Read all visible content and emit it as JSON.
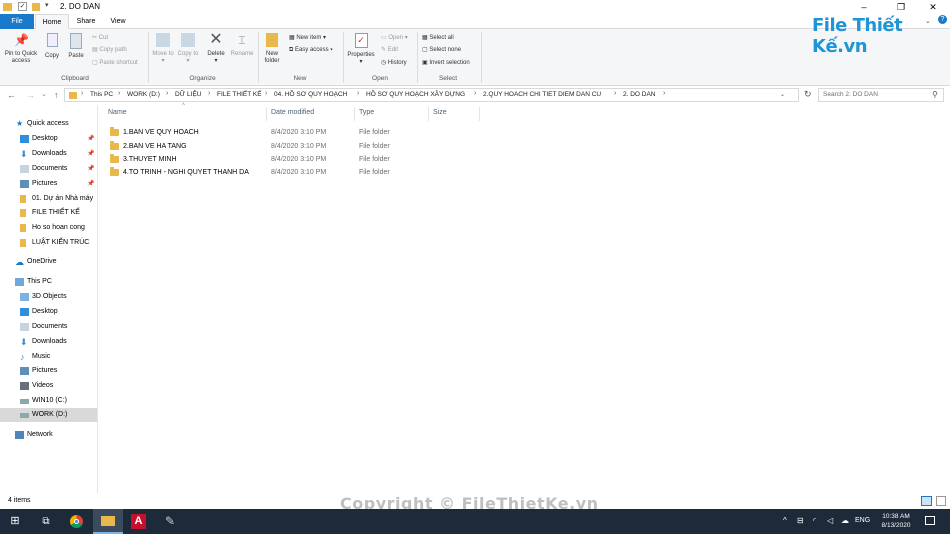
{
  "window": {
    "title": "2. DO DAN",
    "min": "–",
    "max": "❐",
    "close": "✕"
  },
  "tabs": {
    "file": "File",
    "home": "Home",
    "share": "Share",
    "view": "View"
  },
  "ribbon": {
    "clipboard": {
      "pin": "Pin to Quick access",
      "copy": "Copy",
      "paste": "Paste",
      "cut": "Cut",
      "copy_path": "Copy path",
      "paste_shortcut": "Paste shortcut",
      "group": "Clipboard"
    },
    "organize": {
      "move_to": "Move to",
      "copy_to": "Copy to",
      "delete": "Delete",
      "rename": "Rename",
      "group": "Organize"
    },
    "new": {
      "new_folder": "New folder",
      "new_item": "New item",
      "easy_access": "Easy access",
      "group": "New"
    },
    "open": {
      "properties": "Properties",
      "open": "Open",
      "edit": "Edit",
      "history": "History",
      "group": "Open"
    },
    "select": {
      "select_all": "Select all",
      "select_none": "Select none",
      "invert": "Invert selection",
      "group": "Select"
    }
  },
  "logo": "File Thiết Kế.vn",
  "address": {
    "crumbs": [
      "This PC",
      "WORK (D:)",
      "DỮ LIỆU",
      "FILE THIẾT KẾ",
      "04. HỒ SƠ QUY HOẠCH",
      "HỒ SƠ QUY HOẠCH XÂY DỰNG",
      "2.QUY HOACH CHI TIET DIEM DAN CU",
      "2. DO DAN"
    ],
    "search_placeholder": "Search 2. DO DAN"
  },
  "nav": {
    "quick_access": "Quick access",
    "quick_items": [
      "Desktop",
      "Downloads",
      "Documents",
      "Pictures",
      "01. Dự án Nhà máy",
      "FILE THIẾT KẾ",
      "Ho so hoan cong",
      "LUẬT KIẾN TRÚC"
    ],
    "onedrive": "OneDrive",
    "this_pc": "This PC",
    "pc_items": [
      "3D Objects",
      "Desktop",
      "Documents",
      "Downloads",
      "Music",
      "Pictures",
      "Videos",
      "WIN10 (C:)",
      "WORK (D:)"
    ],
    "network": "Network"
  },
  "columns": {
    "name": "Name",
    "date": "Date modified",
    "type": "Type",
    "size": "Size"
  },
  "files": [
    {
      "name": "1.BAN VE QUY HOACH",
      "date": "8/4/2020 3:10 PM",
      "type": "File folder"
    },
    {
      "name": "2.BAN VE HA TANG",
      "date": "8/4/2020 3:10 PM",
      "type": "File folder"
    },
    {
      "name": "3.THUYET MINH",
      "date": "8/4/2020 3:10 PM",
      "type": "File folder"
    },
    {
      "name": "4.TO TRINH - NGHI QUYET THANH DA",
      "date": "8/4/2020 3:10 PM",
      "type": "File folder"
    }
  ],
  "status": {
    "count": "4 items"
  },
  "watermark": "Copyright © FileThietKe.vn",
  "tray": {
    "lang": "ENG",
    "time": "10:38 AM",
    "date": "8/13/2020"
  }
}
